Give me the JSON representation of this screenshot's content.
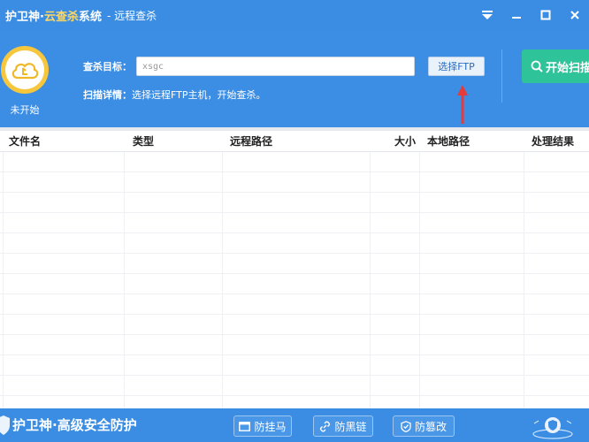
{
  "window": {
    "title_part1": "护卫神·",
    "title_part2": "云查杀",
    "title_part3": "系统",
    "subtitle": "- 远程查杀",
    "controls": [
      "menu-icon",
      "minimize-icon",
      "maximize-icon",
      "close-icon"
    ]
  },
  "status": {
    "label": "未开始",
    "icon": "cloud-icon"
  },
  "scan": {
    "target_label": "查杀目标：",
    "target_value": "xsgc",
    "select_ftp_label": "选择FTP",
    "detail_label": "扫描详情：",
    "detail_text": "选择远程FTP主机，开始查杀。",
    "start_label": "开始扫描"
  },
  "table": {
    "columns": [
      "文件名",
      "类型",
      "远程路径",
      "大小",
      "本地路径",
      "处理结果"
    ],
    "rows": []
  },
  "footer": {
    "slogan": "护卫神·高级安全防护",
    "buttons": [
      "防挂马",
      "防黑链",
      "防篡改"
    ]
  },
  "colors": {
    "primary_blue": "#3b8de3",
    "accent_yellow": "#ffd862",
    "scan_green": "#2fc39a",
    "arrow_red": "#e53b3b"
  }
}
